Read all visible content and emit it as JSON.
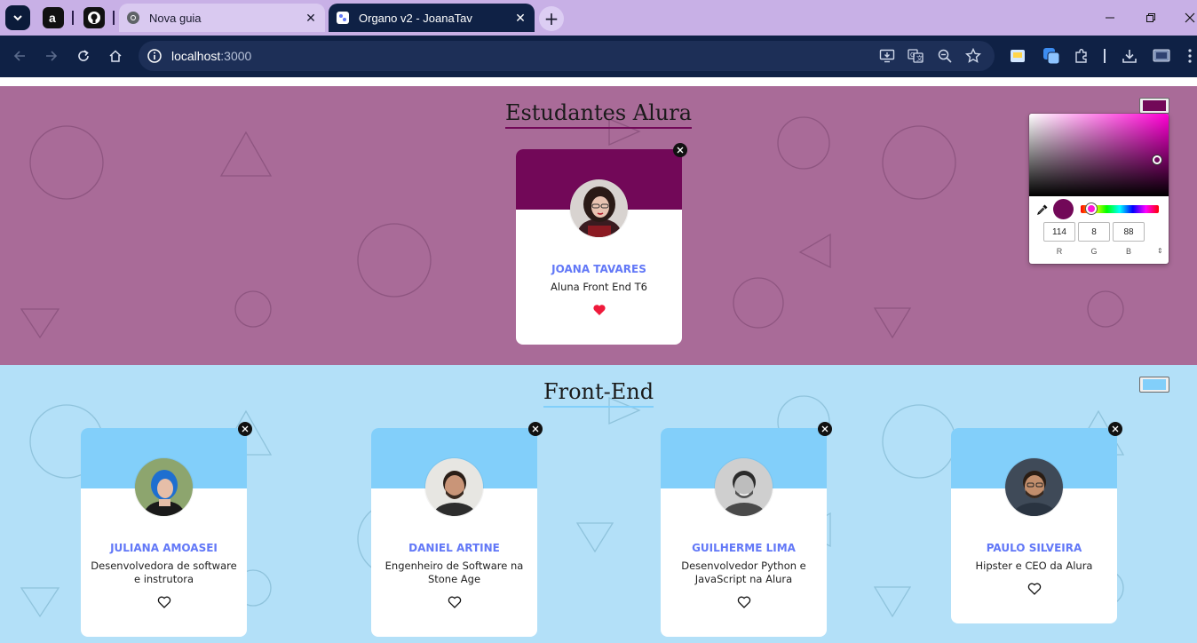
{
  "browser": {
    "tabs": [
      {
        "title": "Nova guia",
        "active": false
      },
      {
        "title": "Organo v2 - JoanaTav",
        "active": true
      }
    ],
    "url_host": "localhost",
    "url_port": ":3000"
  },
  "sections": {
    "students": {
      "title": "Estudantes Alura",
      "primary_color": "#720858",
      "background_color": "#a96b98",
      "members": [
        {
          "name": "JOANA TAVARES",
          "role": "Aluna Front End T6",
          "favorite": true
        }
      ]
    },
    "frontend": {
      "title": "Front-End",
      "primary_color": "#82cffa",
      "background_color": "#b3e0f8",
      "members": [
        {
          "name": "JULIANA AMOASEI",
          "role": "Desenvolvedora de software e instrutora",
          "favorite": false
        },
        {
          "name": "DANIEL ARTINE",
          "role": "Engenheiro de Software na Stone Age",
          "favorite": false
        },
        {
          "name": "GUILHERME LIMA",
          "role": "Desenvolvedor Python e JavaScript na Alura",
          "favorite": false
        },
        {
          "name": "PAULO SILVEIRA",
          "role": "Hipster e CEO da Alura",
          "favorite": false
        }
      ]
    }
  },
  "color_picker": {
    "r": "114",
    "g": "8",
    "b": "88",
    "r_label": "R",
    "g_label": "G",
    "b_label": "B",
    "selected_color": "#720858"
  }
}
